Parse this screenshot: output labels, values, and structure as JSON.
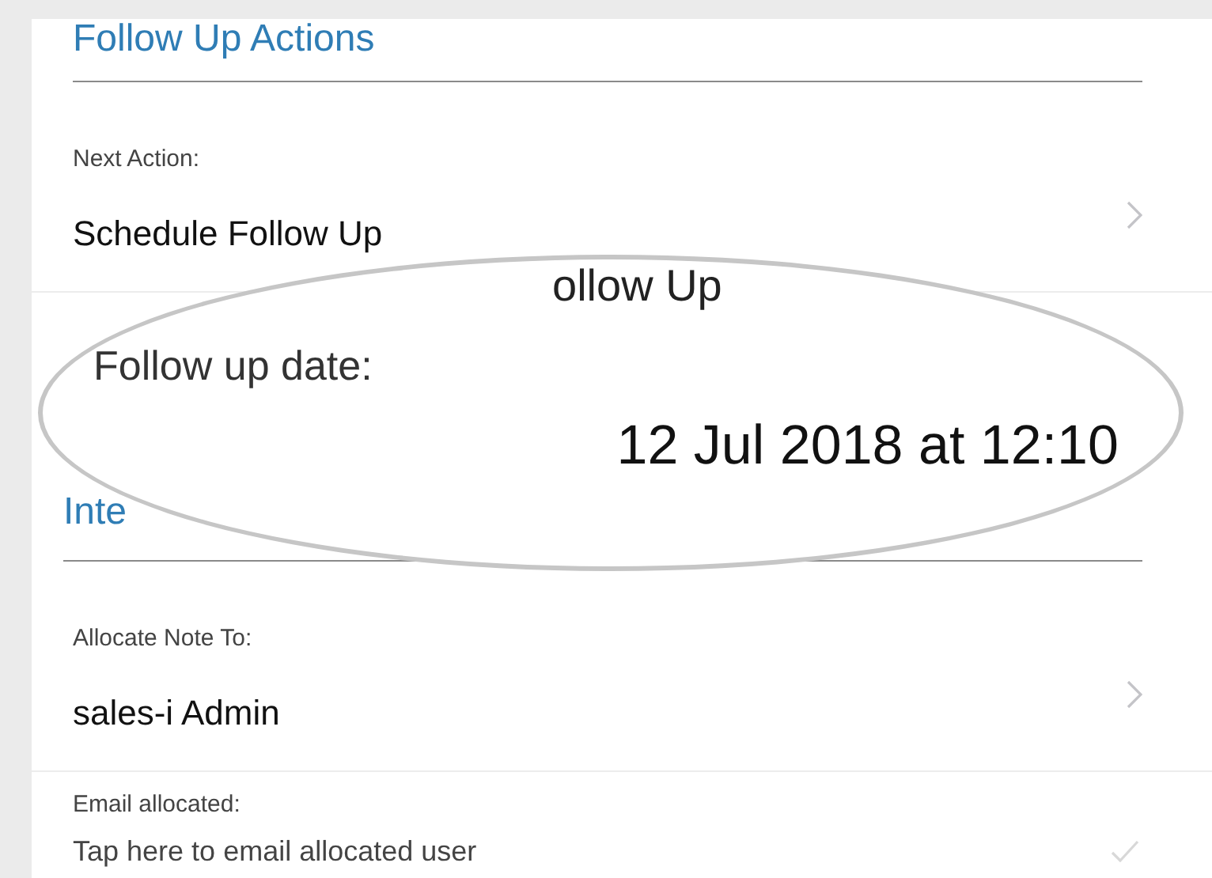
{
  "sections": [
    {
      "header": "Follow Up Actions",
      "fields": [
        {
          "kind": "picker",
          "label": "Next Action:",
          "value": "Schedule Follow Up"
        }
      ]
    },
    {
      "header": "Inte",
      "fields": [
        {
          "kind": "picker",
          "label": "Allocate Note To:",
          "value": "sales-i Admin"
        },
        {
          "kind": "toggle",
          "label": "Email allocated:",
          "value": "Tap here to email allocated user",
          "checked": false
        }
      ]
    }
  ],
  "magnifier": {
    "overflow_text": "ollow Up",
    "label": "Follow up date:",
    "value": "12 Jul 2018 at 12:10"
  }
}
